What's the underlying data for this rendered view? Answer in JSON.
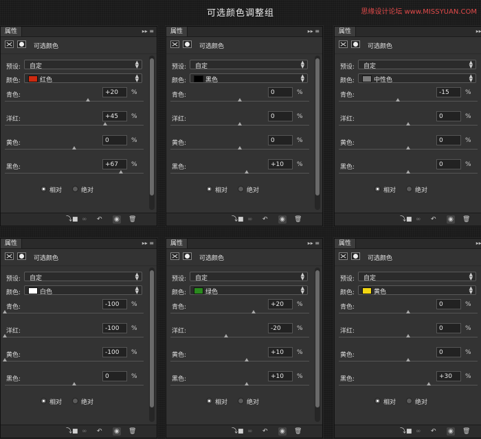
{
  "page_title": "可选颜色调整组",
  "watermark": "思缘设计论坛 www.MISSYUAN.COM",
  "panel_common": {
    "tab_label": "属性",
    "title": "可选颜色",
    "preset_label": "预设:",
    "preset_value": "自定",
    "color_label": "颜色:",
    "channels": [
      "青色:",
      "洋红:",
      "黄色:",
      "黑色:"
    ],
    "relative_label": "相对",
    "absolute_label": "绝对",
    "pct": "%"
  },
  "panels": [
    {
      "color_name": "红色",
      "swatch": "#cc2a10",
      "values": [
        "+20",
        "+45",
        "0",
        "+67"
      ],
      "levels": [
        20,
        45,
        0,
        67
      ]
    },
    {
      "color_name": "黑色",
      "swatch": "#000000",
      "values": [
        "0",
        "0",
        "0",
        "+10"
      ],
      "levels": [
        0,
        0,
        0,
        10
      ]
    },
    {
      "color_name": "中性色",
      "swatch": "#7a7a7a",
      "values": [
        "-15",
        "0",
        "0",
        "0"
      ],
      "levels": [
        -15,
        0,
        0,
        0
      ]
    },
    {
      "color_name": "白色",
      "swatch": "#ffffff",
      "values": [
        "-100",
        "-100",
        "-100",
        "0"
      ],
      "levels": [
        -100,
        -100,
        -100,
        0
      ]
    },
    {
      "color_name": "绿色",
      "swatch": "#2a8a1e",
      "values": [
        "+20",
        "-20",
        "+10",
        "+10"
      ],
      "levels": [
        20,
        -20,
        10,
        10
      ]
    },
    {
      "color_name": "黄色",
      "swatch": "#f2d612",
      "values": [
        "0",
        "0",
        "0",
        "+30"
      ],
      "levels": [
        0,
        0,
        0,
        30
      ]
    }
  ],
  "footer_icons": [
    "clip-to-layer-icon",
    "visibility-toggle-icon",
    "reset-icon",
    "eye-icon",
    "trash-icon"
  ]
}
